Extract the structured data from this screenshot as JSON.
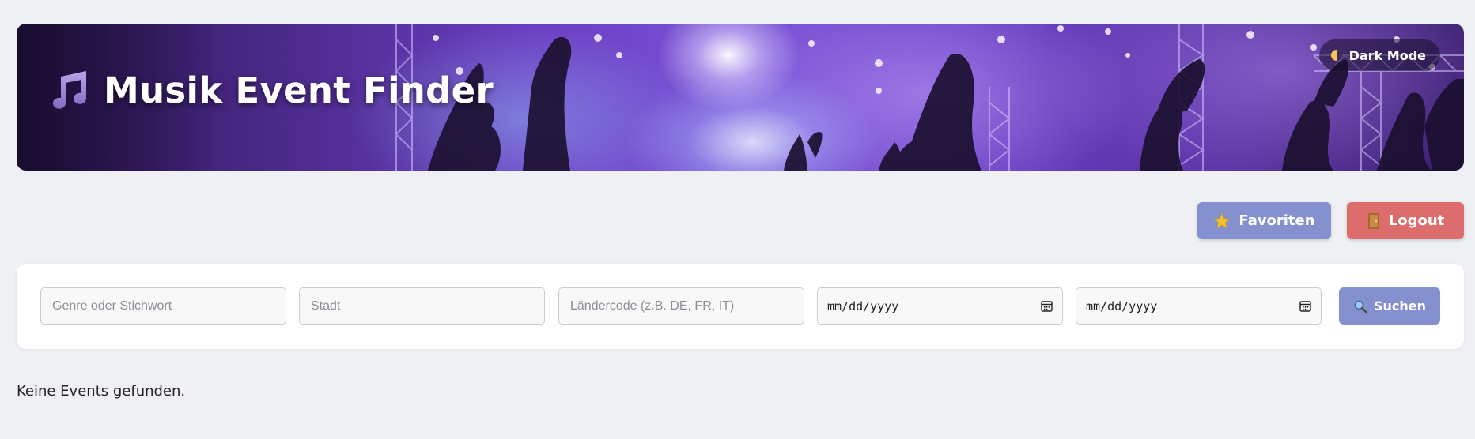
{
  "header": {
    "title": "Musik Event Finder",
    "title_icon": "music-note-icon",
    "dark_mode_label": "Dark Mode",
    "dark_mode_icon": "moon-icon"
  },
  "actions": {
    "favorites_label": "Favoriten",
    "favorites_icon": "star-icon",
    "logout_label": "Logout",
    "logout_icon": "door-icon"
  },
  "search": {
    "genre_placeholder": "Genre oder Stichwort",
    "genre_value": "",
    "city_placeholder": "Stadt",
    "city_value": "",
    "country_placeholder": "Ländercode (z.B. DE, FR, IT)",
    "country_value": "",
    "start_date_placeholder": "mm/dd/yyyy",
    "end_date_placeholder": "mm/dd/yyyy",
    "search_label": "Suchen",
    "search_icon": "magnifier-icon"
  },
  "results": {
    "empty_message": "Keine Events gefunden."
  },
  "colors": {
    "page_background": "#eef0f4",
    "primary_button": "#8590cf",
    "logout_button": "#dd6c6c",
    "card_background": "#ffffff"
  }
}
